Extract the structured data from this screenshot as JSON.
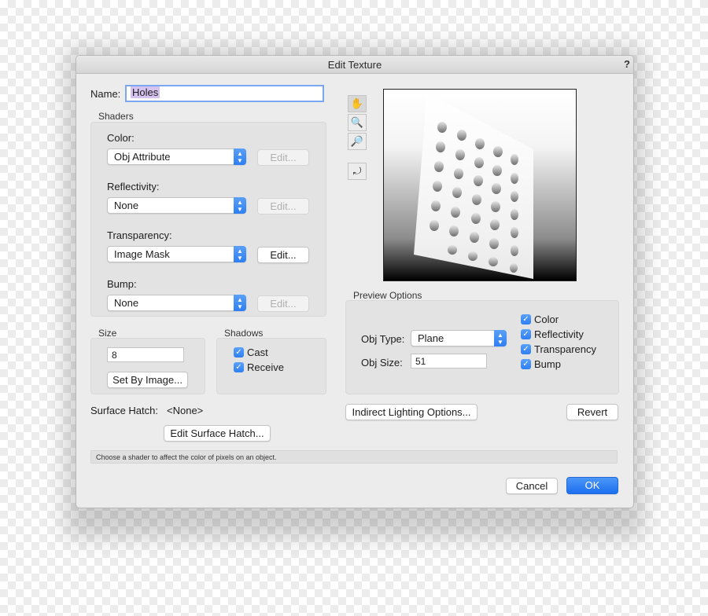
{
  "dialog": {
    "title": "Edit Texture",
    "help": "?",
    "name_label": "Name:",
    "name_value": "Holes",
    "shaders": {
      "label": "Shaders",
      "color": {
        "label": "Color:",
        "value": "Obj Attribute",
        "edit": "Edit..."
      },
      "reflectivity": {
        "label": "Reflectivity:",
        "value": "None",
        "edit": "Edit..."
      },
      "transparency": {
        "label": "Transparency:",
        "value": "Image Mask",
        "edit": "Edit..."
      },
      "bump": {
        "label": "Bump:",
        "value": "None",
        "edit": "Edit..."
      }
    },
    "size": {
      "label": "Size",
      "value": "8",
      "set_by_image": "Set By Image..."
    },
    "shadows": {
      "label": "Shadows",
      "cast": "Cast",
      "receive": "Receive"
    },
    "surface_hatch": {
      "label": "Surface Hatch:",
      "value": "<None>",
      "edit": "Edit Surface Hatch..."
    },
    "preview_options": {
      "label": "Preview Options",
      "obj_type_label": "Obj Type:",
      "obj_type_value": "Plane",
      "obj_size_label": "Obj Size:",
      "obj_size_value": "51",
      "checks": {
        "color": "Color",
        "reflectivity": "Reflectivity",
        "transparency": "Transparency",
        "bump": "Bump"
      }
    },
    "indirect_lighting": "Indirect Lighting Options...",
    "revert": "Revert",
    "status": "Choose a shader to affect the color of pixels on an object.",
    "cancel": "Cancel",
    "ok": "OK"
  },
  "icons": {
    "pan": "hand-icon",
    "zoom_in": "zoom-in-icon",
    "zoom_out": "zoom-out-icon",
    "rotate": "preview-rotate-icon",
    "checkmark": "checkmark-icon"
  },
  "colors": {
    "accent": "#2f7ff2",
    "dialog_bg": "#ececec"
  }
}
